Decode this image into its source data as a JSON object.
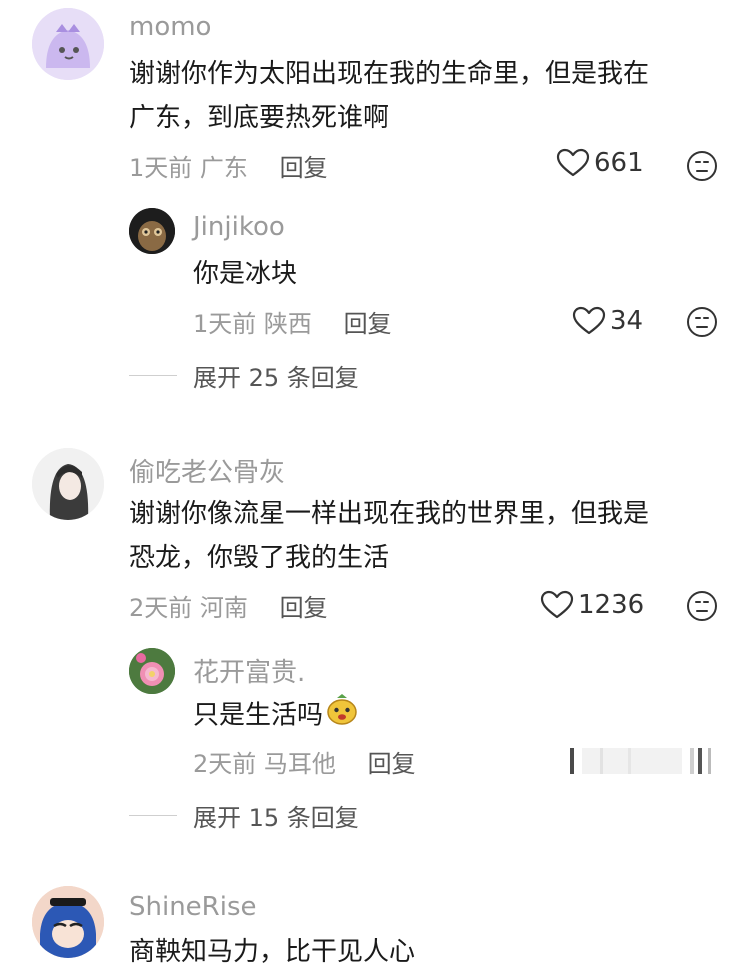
{
  "comments": [
    {
      "username": "momo",
      "text_lines": [
        "谢谢你作为太阳出现在我的生命里，但是我在",
        "广东，到底要热死谁啊"
      ],
      "time": "1天前",
      "location": "广东",
      "reply_label": "回复",
      "likes": "661",
      "reply": {
        "username": "Jinjikoo",
        "text": "你是冰块",
        "time": "1天前",
        "location": "陕西",
        "reply_label": "回复",
        "likes": "34"
      },
      "expand_label": "展开 25 条回复"
    },
    {
      "username": "偷吃老公骨灰",
      "text_lines": [
        "谢谢你像流星一样出现在我的世界里，但我是",
        "恐龙，你毁了我的生活"
      ],
      "time": "2天前",
      "location": "河南",
      "reply_label": "回复",
      "likes": "1236",
      "reply": {
        "username": "花开富贵.",
        "text": "只是生活吗",
        "time": "2天前",
        "location": "马耳他",
        "reply_label": "回复"
      },
      "expand_label": "展开 15 条回复"
    },
    {
      "username": "ShineRise",
      "text_lines": [
        "商鞅知马力，比干见人心"
      ]
    }
  ],
  "icons": {
    "like": "heart-outline-icon",
    "dislike": "neutral-face-icon"
  },
  "colors": {
    "text": "#1a1a1a",
    "meta": "#9a9a9a",
    "avatar_momo": "#ddd3f5",
    "avatar_flower": "#e86aa0"
  }
}
